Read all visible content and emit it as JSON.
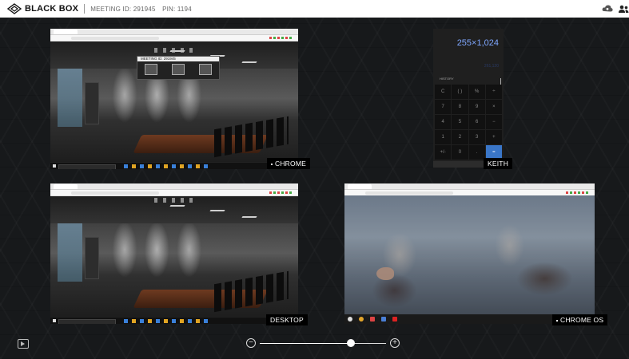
{
  "header": {
    "brand": "BLACK BOX",
    "meeting_label": "MEETING ID: 291945",
    "pin_label": "PIN: 1194",
    "icons": [
      "logo-diamond-icon",
      "cloud-settings-icon",
      "participants-icon"
    ]
  },
  "tiles": [
    {
      "label": "CHROME",
      "source": "chrome-meeting-room"
    },
    {
      "label": "KEITH",
      "source": "calculator"
    },
    {
      "label": "DESKTOP",
      "source": "desktop-meeting-room"
    },
    {
      "label": "CHROME OS",
      "source": "chrome-os-audience"
    }
  ],
  "embedded": {
    "chrome_meeting_title": "MEETING ID: 291945",
    "calculator": {
      "display": "255×1,024",
      "history_label": "HISTORY",
      "keys": [
        "C",
        "( )",
        "%",
        "÷",
        "7",
        "8",
        "9",
        "×",
        "4",
        "5",
        "6",
        "−",
        "1",
        "2",
        "3",
        "+",
        "+/-",
        "0",
        ".",
        "="
      ]
    }
  },
  "zoom": {
    "level": 0.72,
    "minus_icon": "zoom-out-icon",
    "plus_icon": "zoom-in-icon"
  },
  "colors": {
    "background": "#17191b",
    "header": "#ffffff",
    "accent": "#3a76c8"
  }
}
